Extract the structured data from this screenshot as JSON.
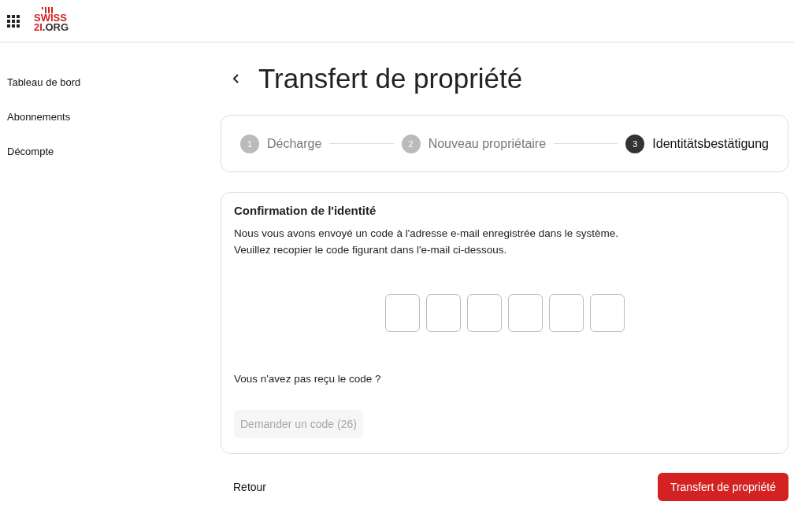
{
  "header": {
    "logo": {
      "top": "SWISS",
      "bottom": "2I",
      "suffix": ".ORG"
    }
  },
  "sidebar": {
    "items": [
      {
        "label": "Tableau de bord",
        "selected": false
      },
      {
        "label": "Abonnements",
        "selected": false
      },
      {
        "label": "Décompte",
        "selected": false
      }
    ]
  },
  "page": {
    "title": "Transfert de propriété"
  },
  "stepper": {
    "steps": [
      {
        "number": "1",
        "label": "Décharge",
        "selected": false
      },
      {
        "number": "2",
        "label": "Nouveau propriétaire",
        "selected": false
      },
      {
        "number": "3",
        "label": "Identitätsbestätigung",
        "selected": true
      }
    ]
  },
  "card": {
    "title": "Confirmation de l'identité",
    "lines": [
      "Nous vous avons envoyé un code à l'adresse e-mail enregistrée dans le système.",
      "Veuillez recopier le code figurant dans l'e-mail ci-dessous."
    ],
    "code_fields": [
      {
        "kind": "digit"
      },
      {
        "kind": "digit"
      },
      {
        "kind": "digit"
      },
      {
        "kind": "digit"
      },
      {
        "kind": "digit"
      },
      {
        "kind": "digit"
      }
    ],
    "question": "Vous n'avez pas reçu le code ?",
    "resend": {
      "label": "Demander un code (26)",
      "disabled": true
    }
  },
  "footer": {
    "back": "Retour",
    "submit": "Transfert de propriété"
  }
}
